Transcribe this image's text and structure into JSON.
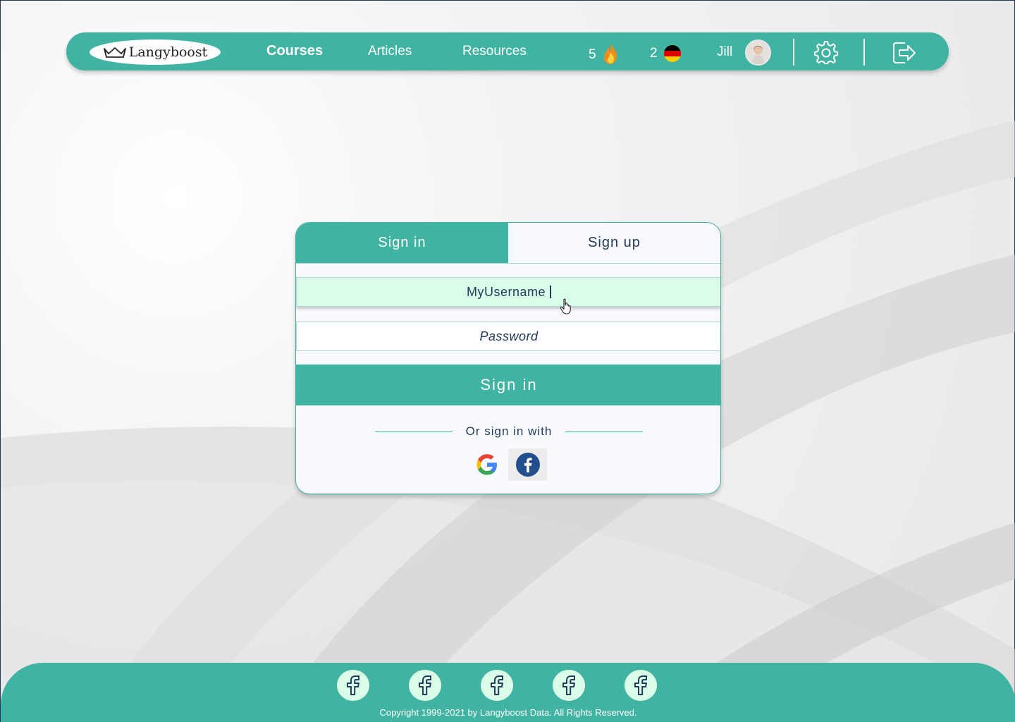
{
  "brand": {
    "name": "Langyboost",
    "accent": "#41b3a3",
    "dark": "#233a5a",
    "field_active_bg": "#dbfde8"
  },
  "nav": {
    "links": [
      {
        "label": "Courses",
        "active": true
      },
      {
        "label": "Articles",
        "active": false
      },
      {
        "label": "Resources",
        "active": false
      }
    ],
    "streak": {
      "count": "5",
      "icon": "flame-icon"
    },
    "language": {
      "count": "2",
      "icon": "german-flag-icon"
    },
    "user": {
      "name": "Jill",
      "avatar": "avatar"
    },
    "settings_icon": "gear-icon",
    "logout_icon": "logout-icon"
  },
  "auth": {
    "tabs": [
      {
        "label": "Sign in",
        "active": true
      },
      {
        "label": "Sign up",
        "active": false
      }
    ],
    "username": {
      "value": "MyUsername"
    },
    "password": {
      "placeholder": "Password"
    },
    "submit_label": "Sign in",
    "or_text": "Or sign in with",
    "providers": [
      {
        "name": "google",
        "icon": "google-icon"
      },
      {
        "name": "facebook",
        "icon": "facebook-icon"
      }
    ]
  },
  "footer": {
    "social_icons": [
      "facebook-icon",
      "facebook-icon",
      "facebook-icon",
      "facebook-icon",
      "facebook-icon"
    ],
    "copyright": "Copyright 1999-2021 by Langyboost Data. All Rights Reserved."
  }
}
